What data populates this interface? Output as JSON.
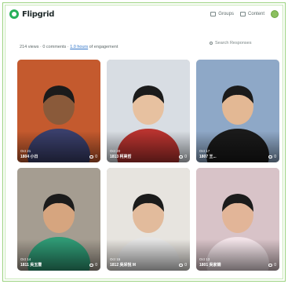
{
  "app": {
    "logo_text": "Flipgrid"
  },
  "nav": {
    "groups": "Groups",
    "content": "Content"
  },
  "search": {
    "placeholder": "Search Responses"
  },
  "stats": {
    "prefix": "214 views · 0 comments · ",
    "link": "1.0 hours",
    "suffix": " of engagement"
  },
  "cards": [
    {
      "date": "Oct 21",
      "name": "1804 小日",
      "comments": "0",
      "bg": "#c45a2e",
      "shirt": "#3a3f6b",
      "skin": "#8a5a3a"
    },
    {
      "date": "Oct 20",
      "name": "1813 柯昊哲",
      "comments": "0",
      "bg": "#d8dde3",
      "shirt": "#b8332f",
      "skin": "#e7c1a0"
    },
    {
      "date": "Oct 17",
      "name": "1807 王...",
      "comments": "0",
      "bg": "#8ea8c7",
      "shirt": "#1a1a1a",
      "skin": "#e3b894"
    },
    {
      "date": "Oct 14",
      "name": "1811 吳玉豐",
      "comments": "0",
      "bg": "#a59d91",
      "shirt": "#2f9a75",
      "skin": "#d6a57f"
    },
    {
      "date": "Oct 15",
      "name": "1812 吳采悅 M",
      "comments": "0",
      "bg": "#e7e4df",
      "shirt": "#e5e5e5",
      "skin": "#e2bb9c"
    },
    {
      "date": "Oct 13",
      "name": "1801 吳家姍",
      "comments": "0",
      "bg": "#d8c3c8",
      "shirt": "#f2e3e8",
      "skin": "#e2b598"
    }
  ]
}
